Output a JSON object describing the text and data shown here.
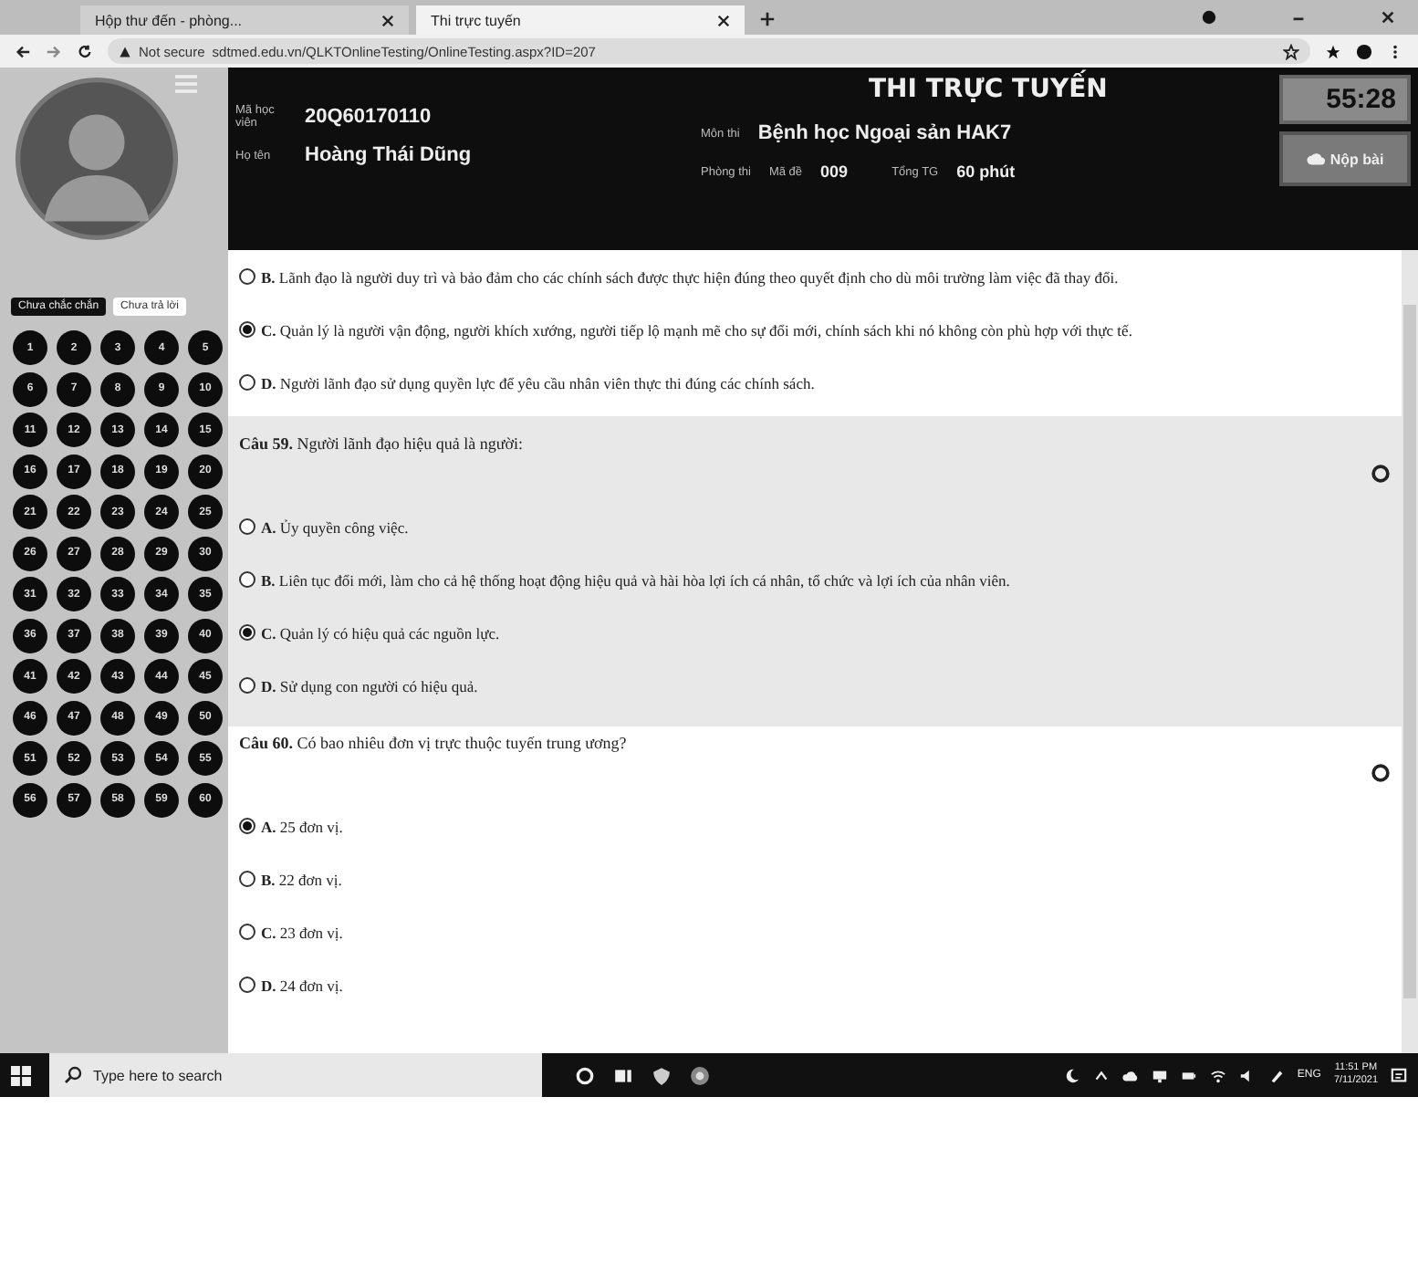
{
  "browser": {
    "tabs": [
      {
        "title": "Hộp thư đến - phòng...",
        "selected": false
      },
      {
        "title": "Thi trực tuyến",
        "selected": true
      }
    ],
    "address": {
      "security": "Not secure",
      "url": "sdtmed.edu.vn/QLKTOnlineTesting/OnlineTesting.aspx?ID=207"
    }
  },
  "header": {
    "title": "THI TRỰC TUYẾN",
    "student": [
      {
        "label": "Mã học viên",
        "value": "20Q60170110"
      },
      {
        "label": "Họ tên",
        "value": "Hoàng Thái Dũng"
      }
    ],
    "subject": {
      "label": "Môn thi",
      "value": "Bệnh học Ngoại sản HAK7"
    },
    "details": [
      {
        "label": "Phòng thi"
      },
      {
        "label": "Mã đề",
        "value": "009"
      },
      {
        "label": "Tổng TG",
        "value": "60 phút"
      }
    ],
    "timer": "55:28",
    "submit_button": "Nộp bài"
  },
  "sidebar": {
    "filters": [
      {
        "label": "Chưa chắc chắn",
        "selected": true
      },
      {
        "label": "Chưa trả lời",
        "selected": false
      }
    ],
    "questions": [
      {
        "number": "1",
        "answered": true
      },
      {
        "number": "2",
        "answered": true
      },
      {
        "number": "3",
        "answered": true
      },
      {
        "number": "4",
        "answered": true
      },
      {
        "number": "5",
        "answered": true
      },
      {
        "number": "6",
        "answered": true
      },
      {
        "number": "7",
        "answered": true
      },
      {
        "number": "8",
        "answered": true
      },
      {
        "number": "9",
        "answered": true
      },
      {
        "number": "10",
        "answered": true
      },
      {
        "number": "11",
        "answered": true
      },
      {
        "number": "12",
        "answered": true
      },
      {
        "number": "13",
        "answered": true
      },
      {
        "number": "14",
        "answered": true
      },
      {
        "number": "15",
        "answered": true
      },
      {
        "number": "16",
        "answered": true
      },
      {
        "number": "17",
        "answered": true
      },
      {
        "number": "18",
        "answered": true
      },
      {
        "number": "19",
        "answered": true
      },
      {
        "number": "20",
        "answered": true
      },
      {
        "number": "21",
        "answered": true
      },
      {
        "number": "22",
        "answered": true
      },
      {
        "number": "23",
        "answered": true
      },
      {
        "number": "24",
        "answered": true
      },
      {
        "number": "25",
        "answered": true
      },
      {
        "number": "26",
        "answered": true
      },
      {
        "number": "27",
        "answered": true
      },
      {
        "number": "28",
        "answered": true
      },
      {
        "number": "29",
        "answered": true
      },
      {
        "number": "30",
        "answered": true
      },
      {
        "number": "31",
        "answered": true
      },
      {
        "number": "32",
        "answered": true
      },
      {
        "number": "33",
        "answered": true
      },
      {
        "number": "34",
        "answered": true
      },
      {
        "number": "35",
        "answered": true
      },
      {
        "number": "36",
        "answered": true
      },
      {
        "number": "37",
        "answered": true
      },
      {
        "number": "38",
        "answered": true
      },
      {
        "number": "39",
        "answered": true
      },
      {
        "number": "40",
        "answered": true
      },
      {
        "number": "41",
        "answered": true
      },
      {
        "number": "42",
        "answered": true
      },
      {
        "number": "43",
        "answered": true
      },
      {
        "number": "44",
        "answered": true
      },
      {
        "number": "45",
        "answered": true
      },
      {
        "number": "46",
        "answered": true
      },
      {
        "number": "47",
        "answered": true
      },
      {
        "number": "48",
        "answered": true
      },
      {
        "number": "49",
        "answered": true
      },
      {
        "number": "50",
        "answered": true
      },
      {
        "number": "51",
        "answered": true
      },
      {
        "number": "52",
        "answered": true
      },
      {
        "number": "53",
        "answered": true
      },
      {
        "number": "54",
        "answered": true
      },
      {
        "number": "55",
        "answered": true
      },
      {
        "number": "56",
        "answered": true
      },
      {
        "number": "57",
        "answered": true
      },
      {
        "number": "58",
        "answered": true
      },
      {
        "number": "59",
        "answered": true
      },
      {
        "number": "60",
        "answered": true
      }
    ]
  },
  "questions": [
    {
      "highlighted": false,
      "options": [
        {
          "letter": "B.",
          "text": "Lãnh đạo là người duy trì và bảo đảm cho các chính sách được thực hiện đúng theo quyết định cho dù môi trường làm việc đã thay đổi.",
          "selected": false
        },
        {
          "letter": "C.",
          "text": "Quản lý là người vận động, người khích xướng, người tiếp lộ mạnh mẽ cho sự đổi mới, chính sách khi nó không còn phù hợp với thực tế.",
          "selected": true
        },
        {
          "letter": "D.",
          "text": "Người lãnh đạo sử dụng quyền lực để yêu cầu nhân viên thực thi đúng các chính sách.",
          "selected": false
        }
      ]
    },
    {
      "number": "Câu 59.",
      "stem": "Người lãnh đạo hiệu quả là người:",
      "highlighted": true,
      "options": [
        {
          "letter": "A.",
          "text": "Ủy quyền công việc.",
          "selected": false
        },
        {
          "letter": "B.",
          "text": "Liên tục đổi mới, làm cho cả hệ thống hoạt động hiệu quả và hài hòa lợi ích cá nhân, tổ chức và lợi ích của nhân viên.",
          "selected": false
        },
        {
          "letter": "C.",
          "text": "Quản lý có hiệu quả các nguồn lực.",
          "selected": true
        },
        {
          "letter": "D.",
          "text": "Sử dụng con người có hiệu quả.",
          "selected": false
        }
      ]
    },
    {
      "number": "Câu 60.",
      "stem": "Có bao nhiêu đơn vị trực thuộc tuyến trung ương?",
      "highlighted": false,
      "options": [
        {
          "letter": "A.",
          "text": "25 đơn vị.",
          "selected": true
        },
        {
          "letter": "B.",
          "text": "22 đơn vị.",
          "selected": false
        },
        {
          "letter": "C.",
          "text": "23 đơn vị.",
          "selected": false
        },
        {
          "letter": "D.",
          "text": "24 đơn vị.",
          "selected": false
        }
      ]
    }
  ],
  "taskbar": {
    "search_placeholder": "Type here to search",
    "language": "ENG",
    "time": "11:51 PM",
    "date": "7/11/2021"
  }
}
